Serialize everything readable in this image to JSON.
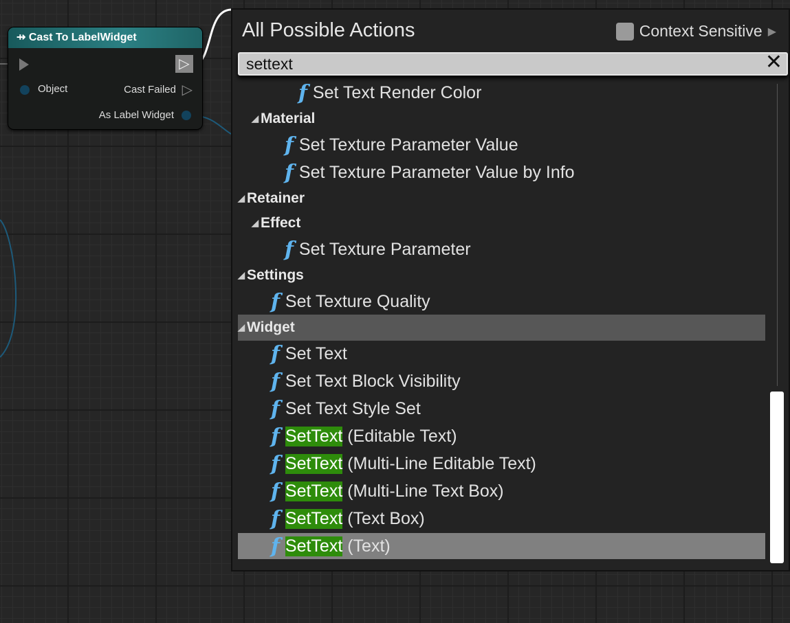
{
  "node": {
    "title": "Cast To LabelWidget",
    "pins": {
      "object": "Object",
      "cast_failed": "Cast Failed",
      "as_label_widget": "As Label Widget"
    },
    "header_color": "#2b8083"
  },
  "panel": {
    "title": "All Possible Actions",
    "context_sensitive_label": "Context Sensitive",
    "context_sensitive_checked": false,
    "search_value": "settext",
    "clear_icon": "close-icon"
  },
  "items": [
    {
      "type": "fn",
      "label": "Set Text Render Color"
    },
    {
      "type": "cat",
      "label": "Material"
    },
    {
      "type": "fn",
      "label": "Set Texture Parameter Value"
    },
    {
      "type": "fn",
      "label": "Set Texture Parameter Value by Info"
    },
    {
      "type": "cat",
      "label": "Retainer"
    },
    {
      "type": "cat",
      "label": "Effect"
    },
    {
      "type": "fn",
      "label": "Set Texture Parameter"
    },
    {
      "type": "cat",
      "label": "Settings"
    },
    {
      "type": "fn",
      "label": "Set Texture Quality"
    },
    {
      "type": "cat",
      "label": "Widget"
    },
    {
      "type": "fn",
      "label": "Set Text"
    },
    {
      "type": "fn",
      "label": "Set Text Block Visibility"
    },
    {
      "type": "fn",
      "label": "Set Text Style Set"
    },
    {
      "type": "fn",
      "match": "SetText",
      "rest": " (Editable Text)"
    },
    {
      "type": "fn",
      "match": "SetText",
      "rest": " (Multi-Line Editable Text)"
    },
    {
      "type": "fn",
      "match": "SetText",
      "rest": " (Multi-Line Text Box)"
    },
    {
      "type": "fn",
      "match": "SetText",
      "rest": " (Text Box)"
    },
    {
      "type": "fn",
      "match": "SetText",
      "rest": " (Text)",
      "selected": true
    }
  ],
  "colors": {
    "match_highlight": "#2e8c0b",
    "function_icon": "#5fb4ee"
  }
}
